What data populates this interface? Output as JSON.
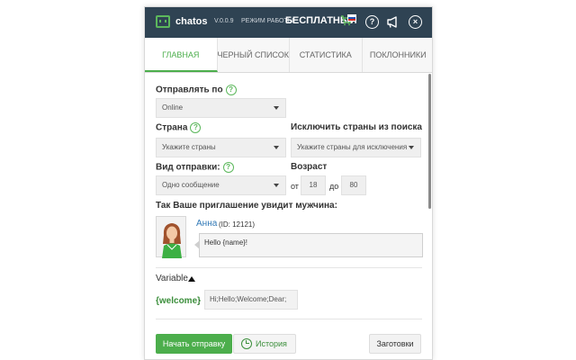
{
  "app": {
    "name": "chatos",
    "version": "V.0.0.9",
    "mode_label": "РЕЖИМ РАБОТЫ",
    "mode_value": "БЕСПЛАТНЫЙ"
  },
  "header_icons": {
    "help": "?",
    "close": "×"
  },
  "tabs": [
    {
      "label": "ГЛАВНАЯ",
      "active": true
    },
    {
      "label": "ЧЕРНЫЙ СПИСОК",
      "active": false
    },
    {
      "label": "СТАТИСТИКА",
      "active": false
    },
    {
      "label": "ПОКЛОННИКИ",
      "active": false
    }
  ],
  "form": {
    "send_to": {
      "label": "Отправлять по",
      "help": "?",
      "value": "Online"
    },
    "country": {
      "label": "Страна",
      "help": "?",
      "placeholder": "Укажите страны"
    },
    "exclude": {
      "label": "Исключить страны из поиска",
      "placeholder": "Укажите страны для исключения"
    },
    "send_type": {
      "label": "Вид отправки:",
      "help": "?",
      "value": "Одно сообщение"
    },
    "age": {
      "label": "Возраст",
      "from_label": "от",
      "from_value": "18",
      "to_label": "до",
      "to_value": "80"
    }
  },
  "preview": {
    "title": "Так Ваше приглашение увидит мужчина:",
    "name": "Анна",
    "id": "(ID: 12121)",
    "message": "Hello {name}!"
  },
  "variable": {
    "label": "Variable",
    "name": "{welcome}",
    "colon": ":",
    "value": "Hi;Hello;Welcome;Dear;"
  },
  "buttons": {
    "start": "Начать отправку",
    "history": "История",
    "templates": "Заготовки"
  },
  "colors": {
    "header_bg": "#2f4353",
    "accent": "#4cae4c",
    "link": "#337ab7"
  }
}
